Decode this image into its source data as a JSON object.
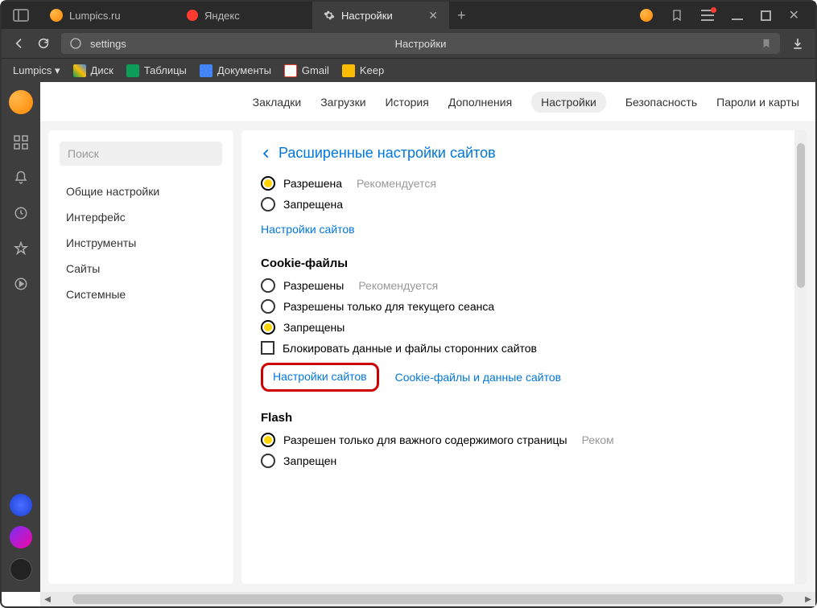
{
  "tabs": [
    {
      "label": "Lumpics.ru",
      "icon_color": "#ff8800"
    },
    {
      "label": "Яндекс",
      "icon_color": "#ff3b30"
    },
    {
      "label": "Настройки",
      "icon_color": "#888",
      "active": true
    }
  ],
  "tabbar_icons": {
    "new_tab": "+"
  },
  "addressbar": {
    "path": "settings",
    "title": "Настройки",
    "protocol_icon": "⊙"
  },
  "bookmarks": [
    {
      "label": "Lumpics ▾",
      "color": ""
    },
    {
      "label": "Диск",
      "color": "#0d9d58"
    },
    {
      "label": "Таблицы",
      "color": "#0d9d58"
    },
    {
      "label": "Документы",
      "color": "#4285f4"
    },
    {
      "label": "Gmail",
      "color": "#ea4335"
    },
    {
      "label": "Keep",
      "color": "#fbbc05"
    }
  ],
  "topnav": [
    "Закладки",
    "Загрузки",
    "История",
    "Дополнения",
    "Настройки",
    "Безопасность",
    "Пароли и карты"
  ],
  "topnav_active": "Настройки",
  "sidebar": {
    "search_placeholder": "Поиск",
    "sections": [
      "Общие настройки",
      "Интерфейс",
      "Инструменты",
      "Сайты",
      "Системные"
    ]
  },
  "panel": {
    "back_title": "Расширенные настройки сайтов",
    "group1": {
      "opt1": "Разрешена",
      "opt1_rec": "Рекомендуется",
      "opt2": "Запрещена",
      "link": "Настройки сайтов"
    },
    "cookies": {
      "title": "Cookie-файлы",
      "opt1": "Разрешены",
      "opt1_rec": "Рекомендуется",
      "opt2": "Разрешены только для текущего сеанса",
      "opt3": "Запрещены",
      "chk": "Блокировать данные и файлы сторонних сайтов",
      "link1": "Настройки сайтов",
      "link2": "Cookie-файлы и данные сайтов"
    },
    "flash": {
      "title": "Flash",
      "opt1": "Разрешен только для важного содержимого страницы",
      "opt1_rec": "Реком",
      "opt2": "Запрещен"
    }
  }
}
